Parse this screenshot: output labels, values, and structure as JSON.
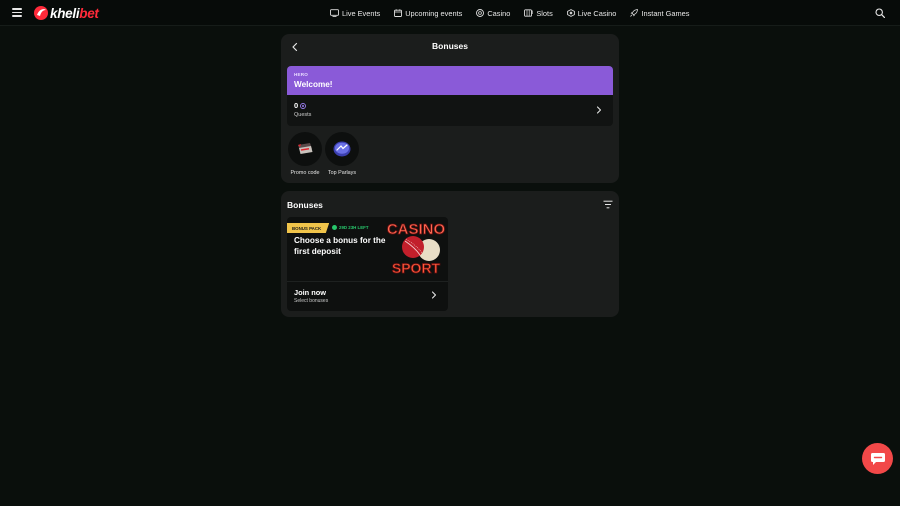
{
  "header": {
    "logo": {
      "prefix": "kheli",
      "accent": "bet"
    },
    "nav": [
      {
        "label": "Live Events",
        "icon": "tv-icon"
      },
      {
        "label": "Upcoming events",
        "icon": "calendar-icon"
      },
      {
        "label": "Casino",
        "icon": "casino-chip-icon"
      },
      {
        "label": "Slots",
        "icon": "slot-machine-icon"
      },
      {
        "label": "Live Casino",
        "icon": "live-casino-icon"
      },
      {
        "label": "Instant Games",
        "icon": "rocket-icon"
      }
    ]
  },
  "bonuses_panel": {
    "title": "Bonuses",
    "hero": {
      "label": "HERO",
      "title": "Welcome!",
      "count": "0",
      "count_label": "Quests"
    },
    "shortcuts": [
      {
        "label": "Promo code",
        "icon": "promo-ticket-icon"
      },
      {
        "label": "Top Parlays",
        "icon": "top-parlays-icon"
      }
    ]
  },
  "bonus_list": {
    "title": "Bonuses",
    "cards": [
      {
        "badge": "BONUS PACK",
        "timer": "29D 23H LEFT",
        "headline": "Choose a bonus for the first deposit",
        "art_text_top": "CASINO",
        "art_text_bottom": "SPORT",
        "action_title": "Join now",
        "action_subtitle": "Select bonuses"
      }
    ]
  },
  "colors": {
    "accent": "#ff2a3a",
    "hero": "#8a5ad8",
    "badge": "#f0c44a",
    "timer": "#27c66b",
    "chat": "#f24848"
  }
}
